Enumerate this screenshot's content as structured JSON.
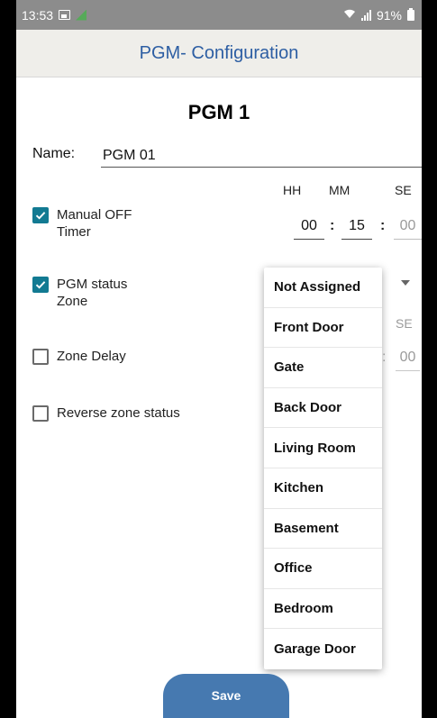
{
  "status_bar": {
    "time": "13:53",
    "battery": "91%"
  },
  "app_bar": {
    "title": "PGM- Configuration"
  },
  "pgm": {
    "title": "PGM 1"
  },
  "name_field": {
    "label": "Name:",
    "value": "PGM 01"
  },
  "manual_off": {
    "line1": "Manual OFF",
    "line2": "Timer",
    "checked": true
  },
  "timer": {
    "headers": [
      "HH",
      "MM",
      "SE"
    ],
    "hh": "00",
    "mm": "15",
    "se": "00",
    "separator": ":"
  },
  "pgm_status": {
    "line1": "PGM status",
    "line2": "Zone",
    "checked": true
  },
  "zone_delay": {
    "label": "Zone Delay",
    "checked": false,
    "se_header": "SE",
    "se_value": "00",
    "separator": ":"
  },
  "reverse_zone": {
    "label": "Reverse zone status",
    "checked": false
  },
  "dropdown": {
    "options": [
      "Not Assigned",
      "Front Door",
      "Gate",
      "Back Door",
      "Living Room",
      "Kitchen",
      "Basement",
      "Office",
      "Bedroom",
      "Garage Door"
    ]
  },
  "save_button": {
    "label": "Save"
  },
  "colors": {
    "accent": "#127a92",
    "title_blue": "#2d5ea3",
    "button": "#4679b0",
    "appbar_bg": "#efeeea"
  },
  "icons": [
    "image-icon",
    "network-icon",
    "wifi-icon",
    "signal-icon",
    "battery-icon",
    "check-icon",
    "dropdown-arrow-icon"
  ]
}
